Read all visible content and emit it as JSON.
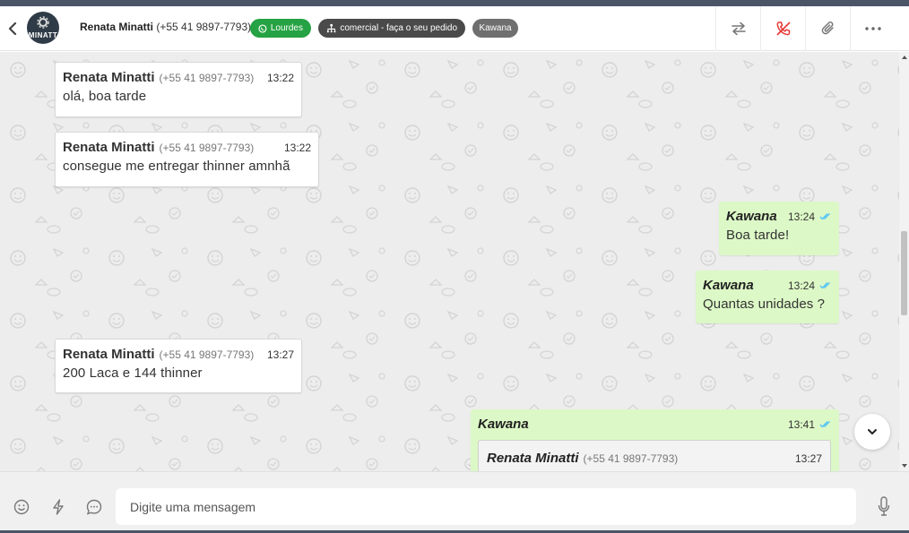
{
  "header": {
    "contact_name": "Renata Minatti",
    "contact_phone": "(+55 41 9897-7793)",
    "avatar_text": "MINATT",
    "tags": {
      "whatsapp": "Lourdes",
      "queue": "comercial - faça o seu pedido",
      "agent": "Kawana"
    },
    "icons": [
      "back-icon",
      "transfer-icon",
      "end-call-icon",
      "attach-icon",
      "more-icon"
    ]
  },
  "colors": {
    "accent_green": "#25a243",
    "incoming_bubble": "#ffffff",
    "outgoing_bubble": "#dcf8c6",
    "chat_background": "#ecedec",
    "read_tick": "#4fc3f7",
    "end_call_red": "#e53935"
  },
  "messages": [
    {
      "direction": "in",
      "sender": "Renata Minatti",
      "phone": "(+55 41 9897-7793)",
      "time": "13:22",
      "text": "olá, boa tarde"
    },
    {
      "direction": "in",
      "sender": "Renata Minatti",
      "phone": "(+55 41 9897-7793)",
      "time": "13:22",
      "text": "consegue me entregar thinner amnhã"
    },
    {
      "direction": "out",
      "sender": "Kawana",
      "time": "13:24",
      "text": "Boa tarde!",
      "status": "read"
    },
    {
      "direction": "out",
      "sender": "Kawana",
      "time": "13:24",
      "text": "Quantas unidades ?",
      "status": "read"
    },
    {
      "direction": "in",
      "sender": "Renata Minatti",
      "phone": "(+55 41 9897-7793)",
      "time": "13:27",
      "text": "200 Laca e 144 thinner"
    },
    {
      "direction": "out",
      "sender": "Kawana",
      "time": "13:41",
      "status": "read",
      "quoted": {
        "sender": "Renata Minatti",
        "phone": "(+55 41 9897-7793)",
        "time": "13:27"
      }
    }
  ],
  "composer": {
    "placeholder": "Digite uma mensagem",
    "icons": [
      "emoji-icon",
      "quick-reply-icon",
      "chat-icon",
      "microphone-icon"
    ]
  }
}
